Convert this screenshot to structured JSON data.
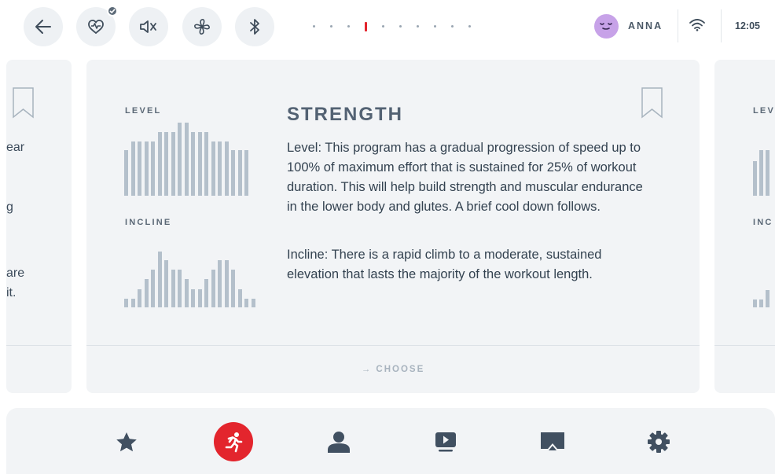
{
  "user": {
    "name": "ANNA"
  },
  "status": {
    "time": "12:05"
  },
  "top_icons": [
    "back-arrow-icon",
    "heart-rate-icon",
    "mute-icon",
    "fan-icon",
    "bluetooth-icon"
  ],
  "pager": {
    "total": 10,
    "active": 3
  },
  "left_card": {
    "text_fragments": [
      "ear",
      "g",
      "are",
      "it."
    ]
  },
  "main_card": {
    "level_label": "LEVEL",
    "incline_label": "INCLINE",
    "title": "STRENGTH",
    "description_level": "Level: This program has a gradual progression of speed up to 100% of maximum effort that is sustained for 25% of workout duration. This will help build strength and muscular endurance in the lower body and glutes. A brief cool down follows.",
    "description_incline": "Incline: There is a rapid climb to a moderate, sustained elevation that lasts the majority of the workout length.",
    "choose_label": "→ CHOOSE",
    "level_profile": [
      0.62,
      0.74,
      0.74,
      0.74,
      0.74,
      0.87,
      0.87,
      0.87,
      1.0,
      1.0,
      0.87,
      0.87,
      0.87,
      0.74,
      0.74,
      0.74,
      0.62,
      0.62,
      0.62
    ],
    "incline_profile": [
      0.16,
      0.16,
      0.33,
      0.5,
      0.67,
      1.0,
      0.85,
      0.67,
      0.67,
      0.5,
      0.33,
      0.33,
      0.5,
      0.67,
      0.85,
      0.85,
      0.67,
      0.33,
      0.16,
      0.16
    ]
  },
  "right_card": {
    "level_label": "LEV",
    "incline_label": "INC"
  },
  "bottom_nav": {
    "items": [
      "star-icon",
      "run-icon",
      "user-icon",
      "video-icon",
      "cast-icon",
      "settings-icon"
    ],
    "active_index": 1
  },
  "colors": {
    "accent": "#e3252d",
    "card_bg": "#f2f4f6",
    "bar": "#b4c0cb",
    "avatar": "#c7a2e8"
  }
}
